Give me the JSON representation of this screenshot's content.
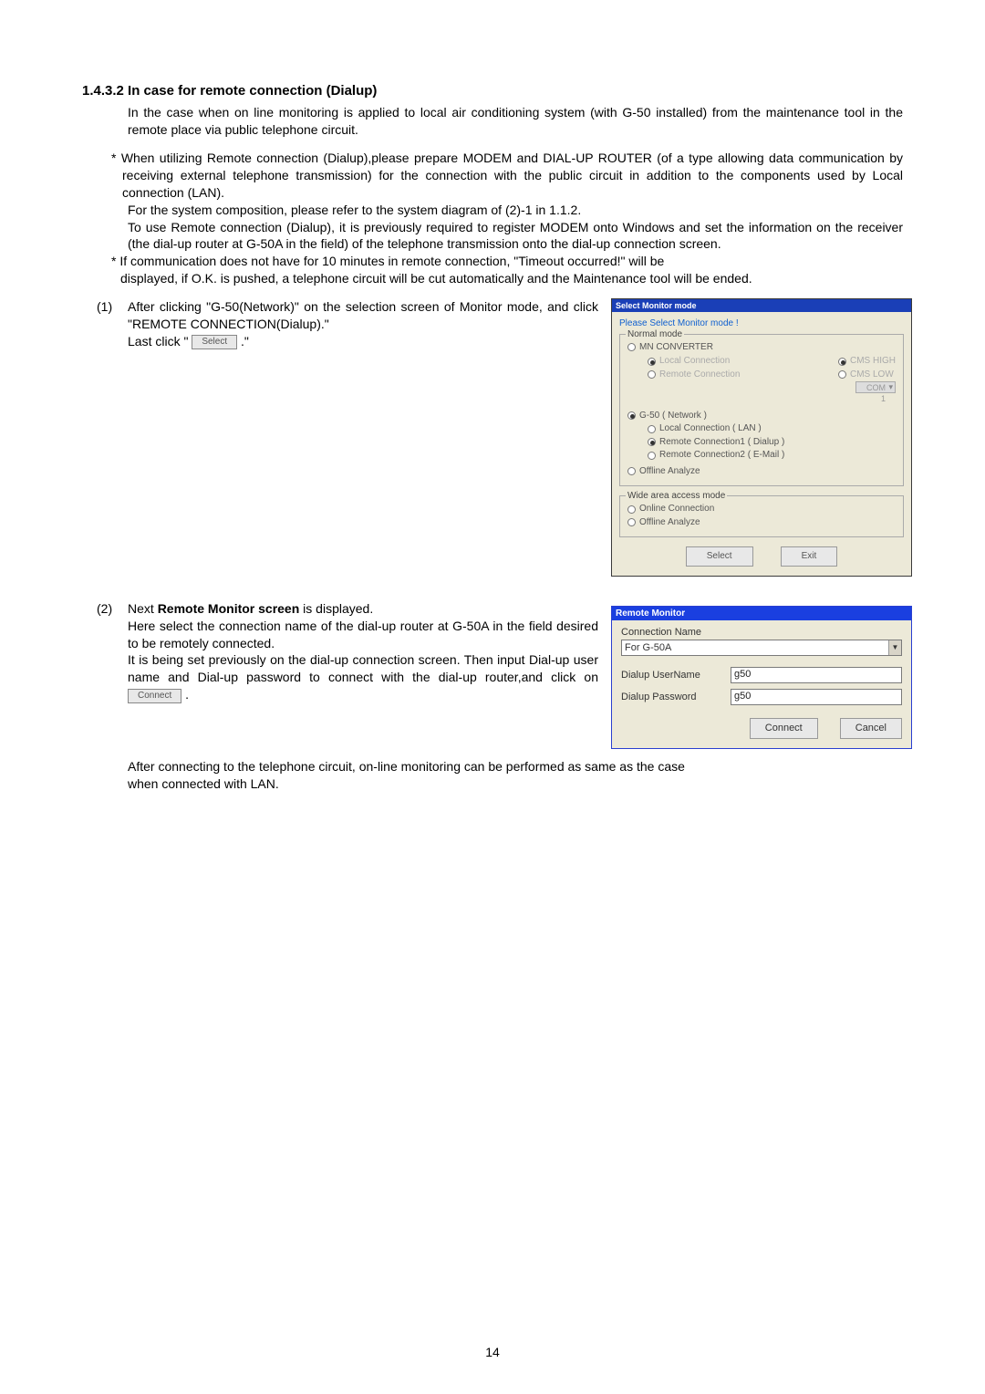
{
  "heading": "1.4.3.2 In case for remote connection (Dialup)",
  "p1": "In the case when on line monitoring is applied to local air conditioning system (with G-50 installed) from the maintenance tool in the remote place via public telephone circuit.",
  "p2a": "* When utilizing Remote connection (Dialup),please prepare MODEM and DIAL-UP ROUTER (of a type allowing data communication by receiving external telephone transmission) for the connection with the public circuit in addition to the components used by Local connection (LAN).",
  "p2b": "For the system composition, please refer to the system diagram of (2)-1 in 1.1.2.",
  "p2c": "To use Remote connection (Dialup), it is previously required to register MODEM onto Windows and set the information on the receiver (the dial-up router at G-50A in the field) of the telephone transmission onto the dial-up connection screen.",
  "p3a": "* If communication does not have for 10 minutes in remote connection, \"Timeout occurred!\" will be",
  "p3b": "displayed, if O.K. is pushed, a telephone circuit will be cut automatically and the Maintenance tool will be ended.",
  "step1num": "(1)",
  "step1a": "After clicking \"G-50(Network)\" on the selection screen of Monitor mode, and click \"REMOTE CONNECTION(Dialup).\"",
  "step1b_pre": "Last click \" ",
  "step1b_btn": "Select",
  "step1b_post": " .\"",
  "step2num": "(2)",
  "step2a_pre": "Next ",
  "step2a_bold": "Remote Monitor screen",
  "step2a_post": " is displayed.",
  "step2b": "Here select the connection name of the dial-up router at G-50A in the field desired to be remotely connected.",
  "step2c_pre": "It is being set previously on the dial-up connection screen. Then input Dial-up user name and Dial-up password to connect with the dial-up router,and click on ",
  "step2c_btn": "Connect",
  "step2c_post": " .",
  "step2d": "After connecting to the telephone circuit, on-line monitoring can be performed as same as the case when connected with LAN.",
  "dlg1": {
    "title": "Select Monitor mode",
    "prompt": "Please Select Monitor mode !",
    "normal_legend": "Normal mode",
    "mn_converter": "MN CONVERTER",
    "local_conn_grey": "Local Connection",
    "remote_conn_grey": "Remote Connection",
    "cms_high": "CMS HIGH",
    "cms_low": "CMS LOW",
    "com_label": "COM 1",
    "g50": "G-50 ( Network )",
    "g50_lan": "Local Connection    ( LAN )",
    "g50_dialup": "Remote Connection1 ( Dialup )",
    "g50_email": "Remote Connection2 ( E-Mail )",
    "offline1": "Offline Analyze",
    "wide_legend": "Wide area access mode",
    "online_conn": "Online Connection",
    "offline2": "Offline Analyze",
    "select_btn": "Select",
    "exit_btn": "Exit"
  },
  "dlg2": {
    "title": "Remote Monitor",
    "conn_name_label": "Connection Name",
    "conn_name_value": "For G-50A",
    "user_label": "Dialup UserName",
    "user_value": "g50",
    "pass_label": "Dialup Password",
    "pass_value": "g50",
    "connect_btn": "Connect",
    "cancel_btn": "Cancel"
  },
  "page_num": "14"
}
